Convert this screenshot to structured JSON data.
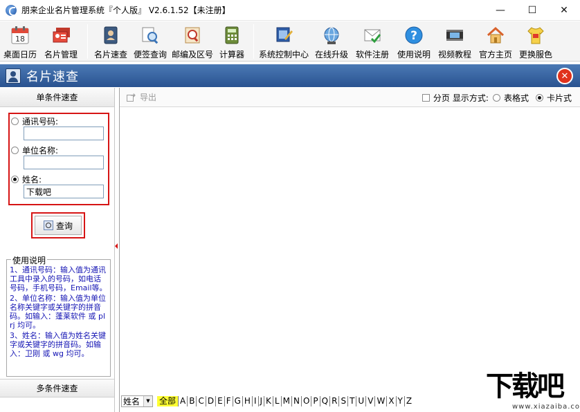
{
  "window": {
    "title": "朋来企业名片管理系统『个人版』 V2.6.1.52【未注册】",
    "controls": {
      "minimize": "—",
      "maximize": "☐",
      "close": "✕"
    }
  },
  "toolbar": {
    "groups": [
      [
        {
          "label": "桌面日历",
          "icon": "calendar-icon"
        },
        {
          "label": "名片管理",
          "icon": "cards-icon"
        }
      ],
      [
        {
          "label": "名片速查",
          "icon": "contact-book-icon"
        },
        {
          "label": "便签查询",
          "icon": "note-search-icon"
        },
        {
          "label": "邮编及区号",
          "icon": "postcode-icon"
        },
        {
          "label": "计算器",
          "icon": "calculator-icon"
        }
      ],
      [
        {
          "label": "系统控制中心",
          "icon": "control-center-icon"
        },
        {
          "label": "在线升级",
          "icon": "online-upgrade-icon"
        },
        {
          "label": "软件注册",
          "icon": "register-icon"
        },
        {
          "label": "使用说明",
          "icon": "help-icon"
        },
        {
          "label": "视频教程",
          "icon": "video-icon"
        },
        {
          "label": "官方主页",
          "icon": "home-icon"
        },
        {
          "label": "更换服色",
          "icon": "skin-icon"
        }
      ]
    ]
  },
  "section": {
    "title": "名片速查",
    "close": "✕"
  },
  "left_panel": {
    "header": "单条件速查",
    "fields": [
      {
        "label": "通讯号码:",
        "value": "",
        "checked": false
      },
      {
        "label": "单位名称:",
        "value": "",
        "checked": false
      },
      {
        "label": "姓名:",
        "value": "下载吧",
        "checked": true
      }
    ],
    "query_button": "查询",
    "help_title": "使用说明",
    "help_lines": [
      "1、通讯号码：输入值为通讯工具中录入的号码，如电话号码，手机号码，Email等。",
      "2、单位名称：输入值为单位名称关键字或关键字的拼音码。如输入：蓬莱软件 或 plrj 均可。",
      "3、姓名：输入值为姓名关键字或关键字的拼音码。如输入：卫刚 或 wg 均可。"
    ],
    "footer": "多条件速查"
  },
  "right_panel": {
    "export_label": "导出",
    "paging_label": "分页",
    "display_mode_label": "显示方式:",
    "mode_table": "表格式",
    "mode_card": "卡片式",
    "selected_mode": "card",
    "sort_field": "姓名",
    "letters": [
      "全部",
      "A",
      "B",
      "C",
      "D",
      "E",
      "F",
      "G",
      "H",
      "I",
      "J",
      "K",
      "L",
      "M",
      "N",
      "O",
      "P",
      "Q",
      "R",
      "S",
      "T",
      "U",
      "V",
      "W",
      "X",
      "Y",
      "Z"
    ]
  },
  "watermark": {
    "main": "下载吧",
    "sub": "www.xiazaiba.com"
  }
}
